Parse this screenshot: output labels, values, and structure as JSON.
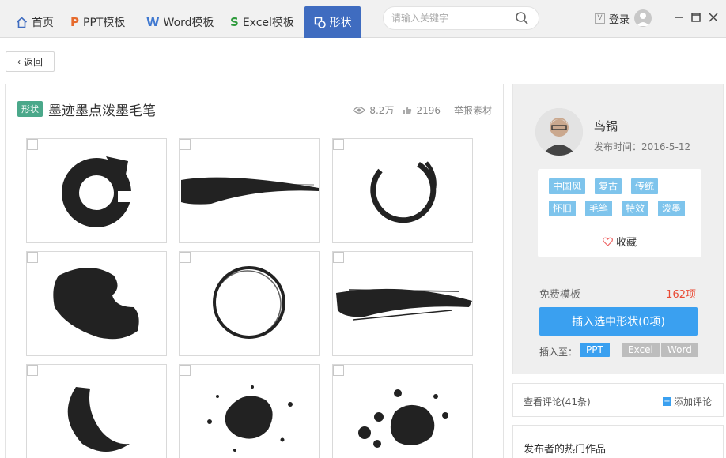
{
  "nav": {
    "tabs": [
      {
        "label": "首页",
        "icon": "home-icon"
      },
      {
        "label": "PPT模板",
        "icon": "ppt-icon"
      },
      {
        "label": "Word模板",
        "icon": "word-icon"
      },
      {
        "label": "Excel模板",
        "icon": "excel-icon"
      },
      {
        "label": "形状",
        "icon": "shape-icon",
        "active": true
      }
    ],
    "search_placeholder": "请输入关键字",
    "login_label": "登录",
    "accent": "#3f6cc0"
  },
  "back_label": "返回",
  "item": {
    "type_tag": "形状",
    "title": "墨迹墨点泼墨毛笔",
    "views": "8.2万",
    "likes": "2196",
    "report_label": "举报素材"
  },
  "author": {
    "name": "鸟锅",
    "publish_time": "发布时间：2016-5-12"
  },
  "tags": [
    "中国风",
    "复古",
    "传统",
    "怀旧",
    "毛笔",
    "特效",
    "泼墨"
  ],
  "favorite_label": "收藏",
  "free_label": "免费模板",
  "free_count": "162项",
  "insert_button": "插入选中形状(0项)",
  "insert_to_label": "插入至：",
  "insert_targets": [
    "PPT",
    "Excel",
    "Word"
  ],
  "comments_label": "查看评论(41条)",
  "add_comment_label": "添加评论",
  "hot_works_label": "发布者的热门作品",
  "colors": {
    "tag_bg": "#7ec4ec",
    "button_blue": "#3aa0f0",
    "count_red": "#e94b35",
    "shape_tag_green": "#4aa88a"
  }
}
